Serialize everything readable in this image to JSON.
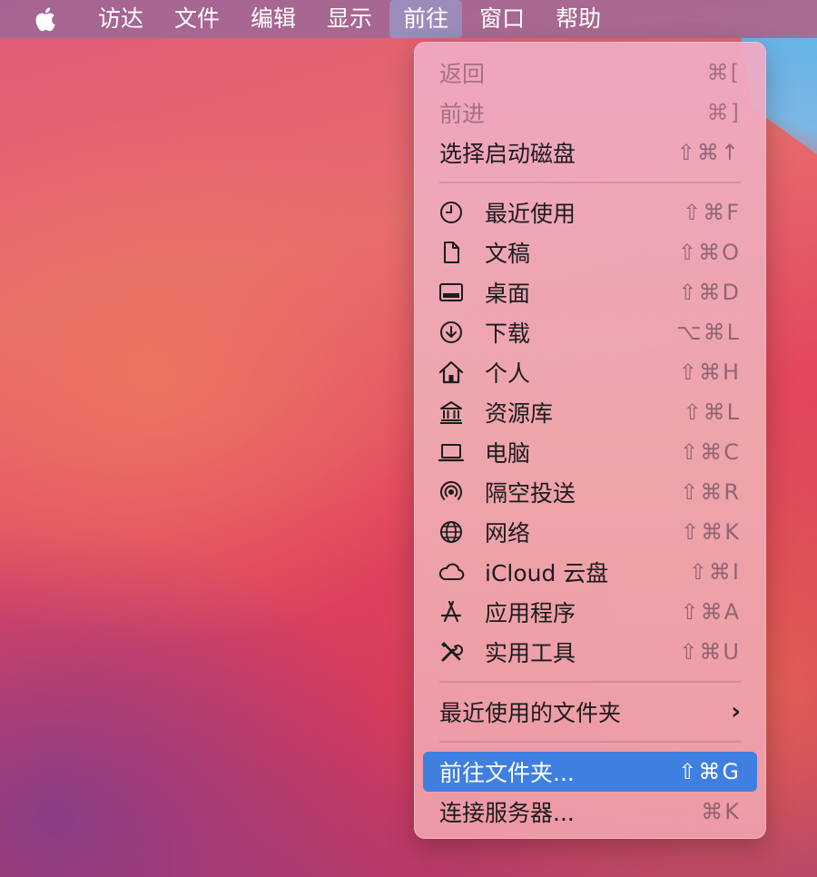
{
  "menubar": {
    "items": [
      {
        "label": "访达"
      },
      {
        "label": "文件"
      },
      {
        "label": "编辑"
      },
      {
        "label": "显示"
      },
      {
        "label": "前往"
      },
      {
        "label": "窗口"
      },
      {
        "label": "帮助"
      }
    ],
    "active_index": 4
  },
  "go_menu": {
    "nav": [
      {
        "label": "返回",
        "shortcut": "⌘[",
        "disabled": true
      },
      {
        "label": "前进",
        "shortcut": "⌘]",
        "disabled": true
      },
      {
        "label": "选择启动磁盘",
        "shortcut": "⇧⌘↑"
      }
    ],
    "places": [
      {
        "label": "最近使用",
        "shortcut": "⇧⌘F",
        "icon": "clock-icon"
      },
      {
        "label": "文稿",
        "shortcut": "⇧⌘O",
        "icon": "document-icon"
      },
      {
        "label": "桌面",
        "shortcut": "⇧⌘D",
        "icon": "desktop-icon"
      },
      {
        "label": "下载",
        "shortcut": "⌥⌘L",
        "icon": "download-icon"
      },
      {
        "label": "个人",
        "shortcut": "⇧⌘H",
        "icon": "home-icon"
      },
      {
        "label": "资源库",
        "shortcut": "⇧⌘L",
        "icon": "library-icon"
      },
      {
        "label": "电脑",
        "shortcut": "⇧⌘C",
        "icon": "laptop-icon"
      },
      {
        "label": "隔空投送",
        "shortcut": "⇧⌘R",
        "icon": "airdrop-icon"
      },
      {
        "label": "网络",
        "shortcut": "⇧⌘K",
        "icon": "globe-icon"
      },
      {
        "label": "iCloud 云盘",
        "shortcut": "⇧⌘I",
        "icon": "cloud-icon"
      },
      {
        "label": "应用程序",
        "shortcut": "⇧⌘A",
        "icon": "applications-icon"
      },
      {
        "label": "实用工具",
        "shortcut": "⇧⌘U",
        "icon": "utilities-icon"
      }
    ],
    "recent_folders": {
      "label": "最近使用的文件夹"
    },
    "go_to_folder": {
      "label": "前往文件夹...",
      "shortcut": "⇧⌘G"
    },
    "connect_server": {
      "label": "连接服务器...",
      "shortcut": "⌘K"
    }
  },
  "colors": {
    "highlight": "#3f7fe0",
    "menubar_active": "#96aadc"
  }
}
